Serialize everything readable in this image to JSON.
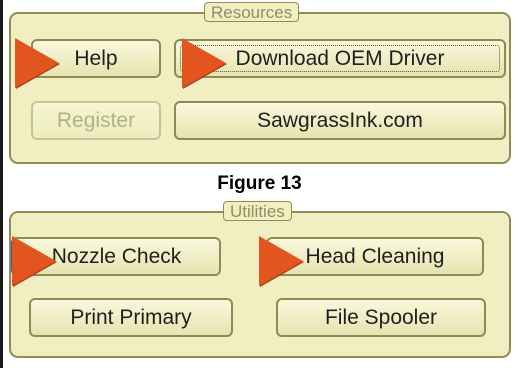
{
  "resources": {
    "title": "Resources",
    "help_label": "Help",
    "download_label": "Download OEM Driver",
    "register_label": "Register",
    "sawgrass_label": "SawgrassInk.com"
  },
  "caption": "Figure 13",
  "utilities": {
    "title": "Utilities",
    "nozzle_label": "Nozzle Check",
    "head_label": "Head Cleaning",
    "print_label": "Print Primary",
    "spooler_label": "File Spooler"
  },
  "colors": {
    "panel_bg": "#f1efc1",
    "panel_border": "#8e8e54",
    "pointer": "#e2551f"
  },
  "icons": {
    "pointer": "orange-triangle-pointer-icon"
  }
}
